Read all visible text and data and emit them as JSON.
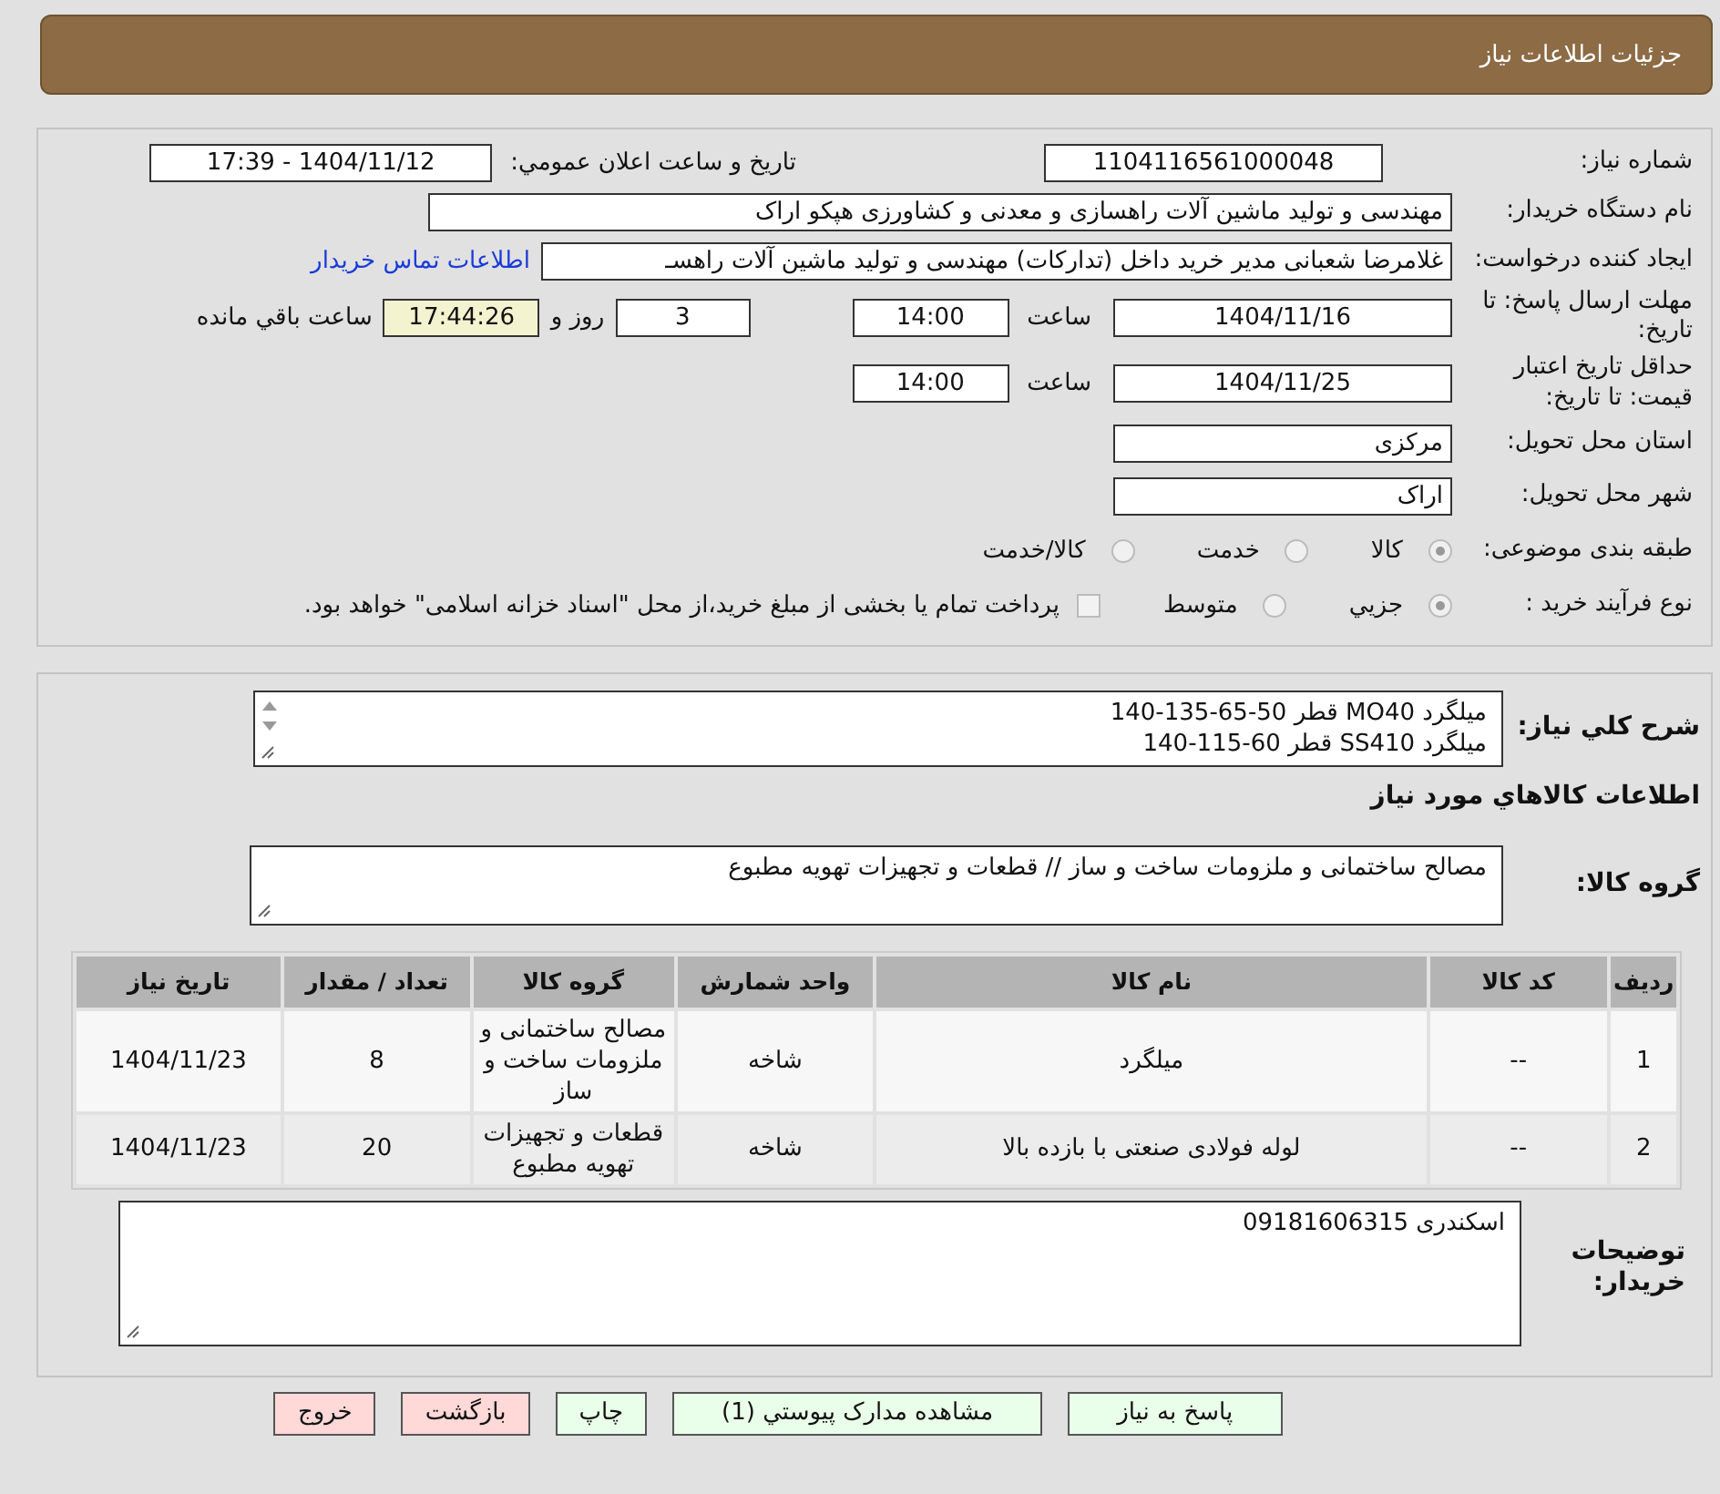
{
  "header": {
    "title": "جزئیات اطلاعات نیاز"
  },
  "need_number": {
    "label": "شماره نیاز:",
    "value": "1104116561000048"
  },
  "announce": {
    "label": "تاریخ و ساعت اعلان عمومي:",
    "value": "1404/11/12 - 17:39"
  },
  "buyer_org": {
    "label": "نام دستگاه خریدار:",
    "value": "مهندسی و تولید ماشین آلات راهسازی و معدنی و کشاورزی هپکو اراک"
  },
  "requester": {
    "label": "ایجاد کننده درخواست:",
    "value": "غلامرضا شعبانی مدیر خرید داخل (تدارکات) مهندسی و تولید ماشین آلات راهسـ",
    "link": "اطلاعات تماس خریدار"
  },
  "response_deadline": {
    "label": "مهلت ارسال پاسخ: تا تاریخ:",
    "date": "1404/11/16",
    "time_label": "ساعت",
    "time": "14:00",
    "days": "3",
    "days_suffix": "روز و",
    "remaining": "17:44:26",
    "remaining_suffix": "ساعت باقي مانده"
  },
  "price_validity": {
    "label": "حداقل تاریخ اعتبار قیمت: تا تاریخ:",
    "date": "1404/11/25",
    "time_label": "ساعت",
    "time": "14:00"
  },
  "province": {
    "label": "استان محل تحویل:",
    "value": "مرکزی"
  },
  "city": {
    "label": "شهر محل تحویل:",
    "value": "اراک"
  },
  "category": {
    "label": "طبقه بندی موضوعی:",
    "options": [
      {
        "label": "کالا",
        "selected": true
      },
      {
        "label": "خدمت",
        "selected": false
      },
      {
        "label": "کالا/خدمت",
        "selected": false
      }
    ]
  },
  "purchase_process": {
    "label": "نوع فرآیند خرید :",
    "options": [
      {
        "label": "جزيي",
        "selected": true
      },
      {
        "label": "متوسط",
        "selected": false
      }
    ],
    "payment": {
      "label": "پرداخت تمام یا بخشی از مبلغ خرید،از محل \"اسناد خزانه اسلامی\" خواهد بود.",
      "checked": false
    }
  },
  "description": {
    "label": "شرح کلي نیاز:",
    "lines": [
      "میلگرد MO40 قطر 50-65-135-140",
      "میلگرد SS410 قطر 60-115-140"
    ]
  },
  "goods_title": "اطلاعات کالاهاي مورد نیاز",
  "goods_group": {
    "label": "گروه کالا:",
    "value": "مصالح ساختمانی و ملزومات ساخت و ساز //  قطعات و تجهیزات تهویه مطبوع"
  },
  "table": {
    "columns": [
      "ردیف",
      "کد کالا",
      "نام کالا",
      "واحد شمارش",
      "گروه کالا",
      "تعداد / مقدار",
      "تاریخ نیاز"
    ],
    "rows": [
      [
        "1",
        "--",
        "میلگرد",
        "شاخه",
        "مصالح ساختمانی و ملزومات ساخت و ساز",
        "8",
        "1404/11/23"
      ],
      [
        "2",
        "--",
        "لوله فولادی صنعتی با بازده بالا",
        "شاخه",
        "قطعات و تجهیزات تهویه مطبوع",
        "20",
        "1404/11/23"
      ]
    ]
  },
  "buyer_notes": {
    "label": "توضیحات خریدار:",
    "value": "اسکندری 09181606315"
  },
  "buttons": [
    {
      "label": "پاسخ به نیاز",
      "kind": "action"
    },
    {
      "label": "مشاهده مدارک پیوستي (1)",
      "kind": "action"
    },
    {
      "label": "چاپ",
      "kind": "action"
    },
    {
      "label": "بازگشت",
      "kind": "exit"
    },
    {
      "label": "خروج",
      "kind": "exit"
    }
  ]
}
